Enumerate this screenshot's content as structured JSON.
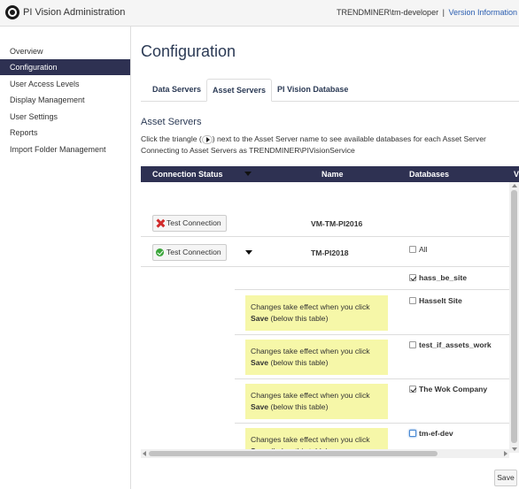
{
  "header": {
    "app_title": "PI Vision Administration",
    "user": "TRENDMINER\\tm-developer",
    "separator": "|",
    "version_link": "Version Information"
  },
  "sidebar": {
    "items": [
      {
        "label": "Overview",
        "active": false
      },
      {
        "label": "Configuration",
        "active": true
      },
      {
        "label": "User Access Levels",
        "active": false
      },
      {
        "label": "Display Management",
        "active": false
      },
      {
        "label": "User Settings",
        "active": false
      },
      {
        "label": "Reports",
        "active": false
      },
      {
        "label": "Import Folder Management",
        "active": false
      }
    ]
  },
  "main": {
    "title": "Configuration",
    "tabs": [
      {
        "label": "Data Servers",
        "active": false
      },
      {
        "label": "Asset Servers",
        "active": true
      },
      {
        "label": "PI Vision Database",
        "active": false
      }
    ],
    "section_title": "Asset Servers",
    "description_before": "Click the triangle (",
    "description_after": ") next to the Asset Server name to see available databases for each Asset Server",
    "description_line2": "Connecting to Asset Servers as TRENDMINER\\PIVisionService"
  },
  "table": {
    "headers": {
      "connection_status": "Connection Status",
      "name": "Name",
      "databases": "Databases",
      "extra": "V"
    },
    "rows": [
      {
        "button": "Test Connection",
        "status": "failed",
        "name": "VM-TM-PI2016"
      },
      {
        "button": "Test Connection",
        "status": "ok",
        "name": "TM-PI2018",
        "all_label": "All"
      }
    ],
    "databases": [
      {
        "label": "hass_be_site",
        "checked": true,
        "note": false
      },
      {
        "label": "Hasselt Site",
        "checked": false,
        "note": true
      },
      {
        "label": "test_if_assets_work",
        "checked": false,
        "note": true
      },
      {
        "label": "The Wok Company",
        "checked": true,
        "note": true
      },
      {
        "label": "tm-ef-dev",
        "checked": false,
        "note": true
      }
    ],
    "note": {
      "line1": "Changes take effect when you click",
      "bold": "Save",
      "line2": " (below this table)"
    }
  },
  "footer": {
    "save_label": "Save"
  }
}
